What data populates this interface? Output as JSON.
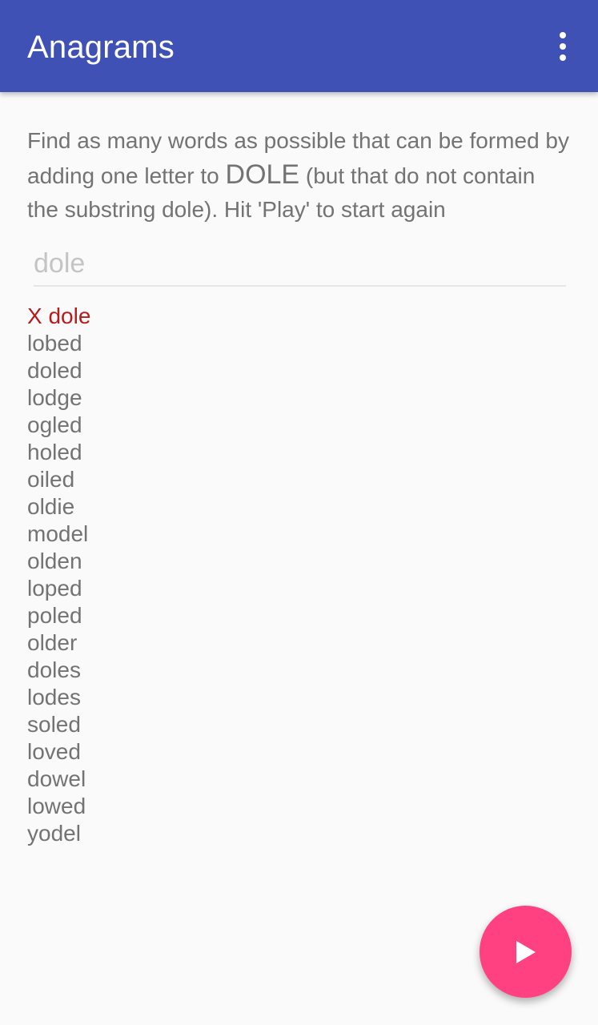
{
  "app_bar": {
    "title": "Anagrams",
    "menu_icon": "more-vert-icon"
  },
  "instructions": {
    "part1": "Find as many words as possible that can be formed by adding one letter to ",
    "starter_word": "DOLE",
    "part2": " (but that do not contain the substring dole). Hit 'Play' to start again"
  },
  "guess_input": {
    "value": "",
    "placeholder": "dole"
  },
  "words": [
    {
      "text": "X dole",
      "status": "wrong"
    },
    {
      "text": "lobed",
      "status": "missed"
    },
    {
      "text": "doled",
      "status": "missed"
    },
    {
      "text": "lodge",
      "status": "missed"
    },
    {
      "text": "ogled",
      "status": "missed"
    },
    {
      "text": "holed",
      "status": "missed"
    },
    {
      "text": "oiled",
      "status": "missed"
    },
    {
      "text": "oldie",
      "status": "missed"
    },
    {
      "text": "model",
      "status": "missed"
    },
    {
      "text": "olden",
      "status": "missed"
    },
    {
      "text": "loped",
      "status": "missed"
    },
    {
      "text": "poled",
      "status": "missed"
    },
    {
      "text": "older",
      "status": "missed"
    },
    {
      "text": "doles",
      "status": "missed"
    },
    {
      "text": "lodes",
      "status": "missed"
    },
    {
      "text": "soled",
      "status": "missed"
    },
    {
      "text": "loved",
      "status": "missed"
    },
    {
      "text": "dowel",
      "status": "missed"
    },
    {
      "text": "lowed",
      "status": "missed"
    },
    {
      "text": "yodel",
      "status": "missed"
    }
  ],
  "fab": {
    "icon": "play-icon"
  },
  "colors": {
    "primary": "#3f51b5",
    "accent": "#ff4081",
    "wrong": "#b71c1c",
    "text": "#737373"
  }
}
